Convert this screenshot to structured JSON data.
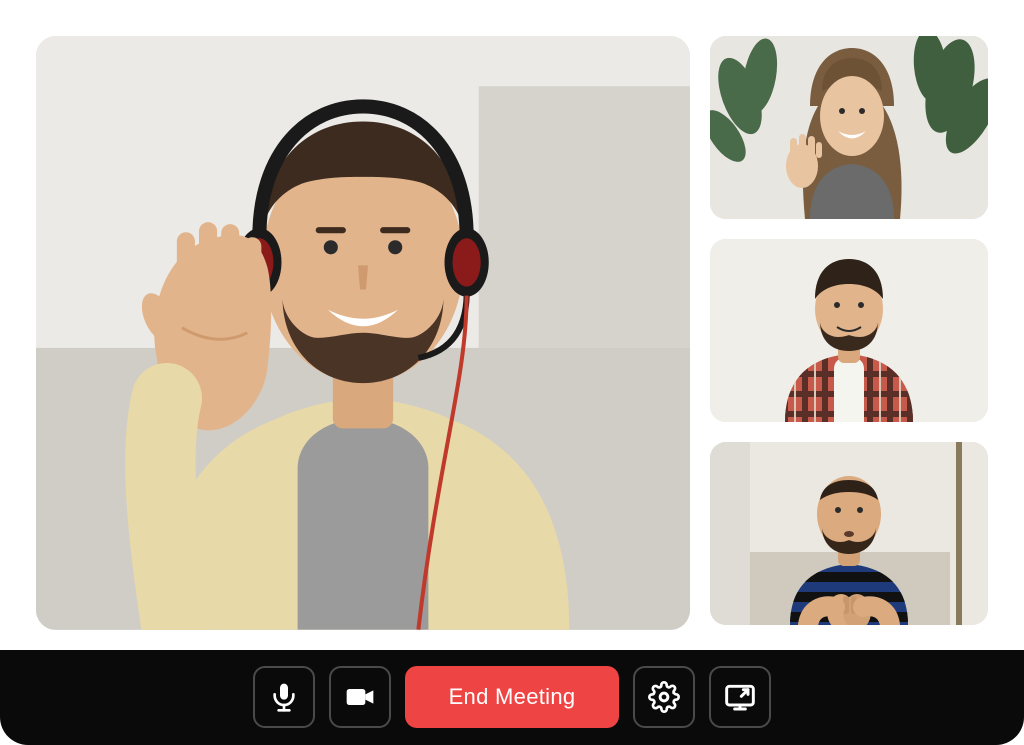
{
  "participants": {
    "main": {
      "name": "participant-main",
      "icon_name": "person-waving-headset"
    },
    "thumbnails": [
      {
        "name": "participant-2",
        "icon_name": "person-waving-woman"
      },
      {
        "name": "participant-3",
        "icon_name": "person-plaid-shirt"
      },
      {
        "name": "participant-4",
        "icon_name": "person-clasped-hands"
      }
    ]
  },
  "toolbar": {
    "mic_icon": "microphone-icon",
    "camera_icon": "camera-icon",
    "end_label": "End Meeting",
    "settings_icon": "gear-icon",
    "share_icon": "screen-share-icon"
  },
  "colors": {
    "end_button": "#ef4444",
    "toolbar_bg": "#0a0a0a",
    "icon_border": "#4a4a4a"
  }
}
